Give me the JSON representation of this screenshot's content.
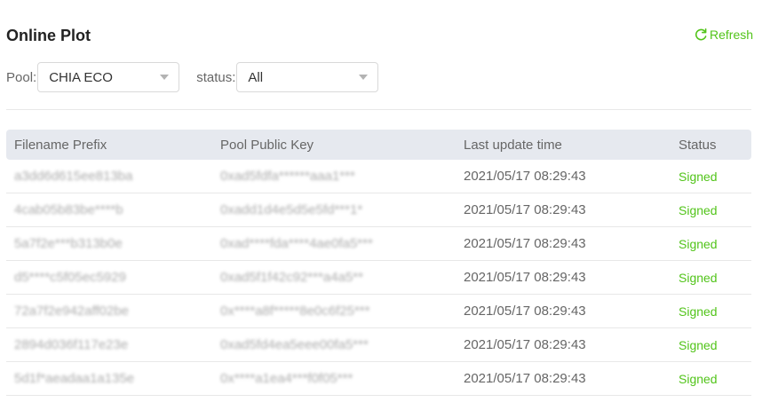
{
  "page": {
    "title": "Online Plot",
    "refresh_label": "Refresh",
    "accent_color": "#52c41a"
  },
  "filters": {
    "pool_label": "Pool:",
    "pool_value": "CHIA ECO",
    "status_label": "status:",
    "status_value": "All"
  },
  "table": {
    "headers": [
      "Filename Prefix",
      "Pool Public Key",
      "Last update time",
      "Status"
    ],
    "rows": [
      {
        "prefix": "a3dd6d615ee813ba",
        "key": "0xad5fdfa******aaa1***",
        "time": "2021/05/17 08:29:43",
        "status": "Signed"
      },
      {
        "prefix": "4cab05b83be****b",
        "key": "0xadd1d4e5d5e5fd***1*",
        "time": "2021/05/17 08:29:43",
        "status": "Signed"
      },
      {
        "prefix": "5a7f2e***b313b0e",
        "key": "0xad****fda****4ae0fa5***",
        "time": "2021/05/17 08:29:43",
        "status": "Signed"
      },
      {
        "prefix": "d5****c5f05ec5929",
        "key": "0xad5f1f42c92***a4a5**",
        "time": "2021/05/17 08:29:43",
        "status": "Signed"
      },
      {
        "prefix": "72a7f2e942aff02be",
        "key": "0x****a8f*****8e0c6f25***",
        "time": "2021/05/17 08:29:43",
        "status": "Signed"
      },
      {
        "prefix": "2894d036f117e23e",
        "key": "0xad5fd4ea5eee00fa5***",
        "time": "2021/05/17 08:29:43",
        "status": "Signed"
      },
      {
        "prefix": "5d1f*aeadaa1a135e",
        "key": "0x****a1ea4***f0f05***",
        "time": "2021/05/17 08:29:43",
        "status": "Signed"
      }
    ]
  }
}
